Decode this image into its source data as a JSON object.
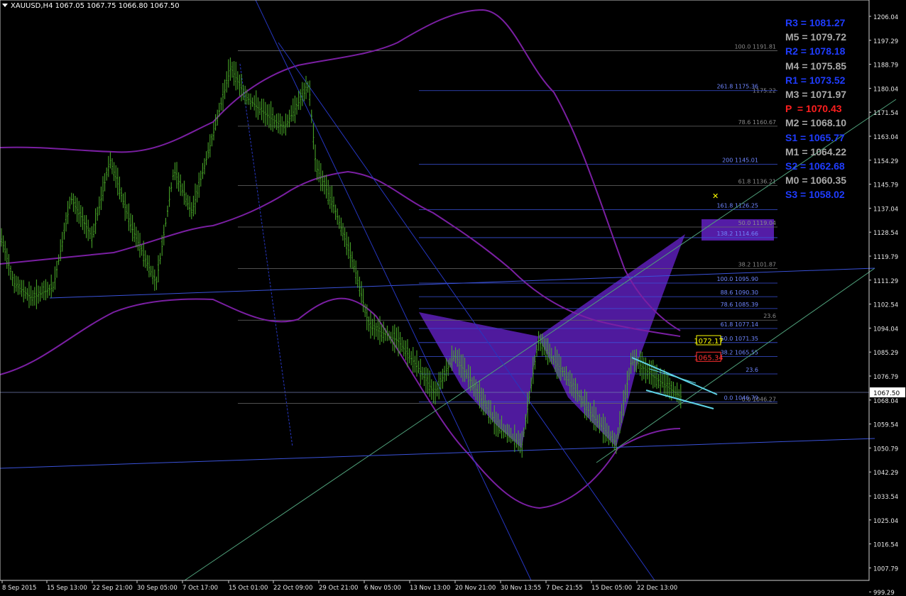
{
  "header": {
    "symbol": "XAUUSD,H4",
    "ohlc": "1067.05 1067.75 1066.80 1067.50"
  },
  "current_price": {
    "value": 1067.5,
    "label": "1067.50"
  },
  "price_axis": {
    "labels": [
      "1206.04",
      "1197.29",
      "1188.79",
      "1180.04",
      "1171.54",
      "1163.04",
      "1154.29",
      "1145.79",
      "1137.04",
      "1128.54",
      "1119.79",
      "1111.29",
      "1102.54",
      "1094.04",
      "1085.29",
      "1076.79",
      "1068.04",
      "1059.54",
      "1050.79",
      "1042.29",
      "1033.54",
      "1025.04",
      "1016.54",
      "1007.79",
      "999.29"
    ]
  },
  "time_axis": {
    "labels": [
      "8 Sep 2015",
      "15 Sep 13:00",
      "22 Sep 21:00",
      "30 Sep 05:00",
      "7 Oct 17:00",
      "15 Oct 01:00",
      "22 Oct 09:00",
      "29 Oct 21:00",
      "6 Nov 05:00",
      "13 Nov 13:00",
      "20 Nov 21:00",
      "30 Nov 13:55",
      "7 Dec 21:55",
      "15 Dec 05:00",
      "22 Dec 13:00"
    ]
  },
  "pivots": [
    {
      "label": "R3",
      "value": "1081.27",
      "color": "#1f3cff"
    },
    {
      "label": "M5",
      "value": "1079.72",
      "color": "#a9a9a9"
    },
    {
      "label": "R2",
      "value": "1078.18",
      "color": "#1f3cff"
    },
    {
      "label": "M4",
      "value": "1075.85",
      "color": "#a9a9a9"
    },
    {
      "label": "R1",
      "value": "1073.52",
      "color": "#1f3cff"
    },
    {
      "label": "M3",
      "value": "1071.97",
      "color": "#a9a9a9"
    },
    {
      "label": "P ",
      "value": "1070.43",
      "color": "#ff1f1f"
    },
    {
      "label": "M2",
      "value": "1068.10",
      "color": "#a9a9a9"
    },
    {
      "label": "S1",
      "value": "1065.77",
      "color": "#1f3cff"
    },
    {
      "label": "M1",
      "value": "1064.22",
      "color": "#a9a9a9"
    },
    {
      "label": "S2",
      "value": "1062.68",
      "color": "#1f3cff"
    },
    {
      "label": "M0",
      "value": "1060.35",
      "color": "#a9a9a9"
    },
    {
      "label": "S3",
      "value": "1058.02",
      "color": "#1f3cff"
    }
  ],
  "fib_grey": [
    {
      "label": "100.0 1191.81",
      "price": 1191.81
    },
    {
      "label": "78.6 1160.67",
      "price": 1160.67
    },
    {
      "label": "61.8 1136.21",
      "price": 1136.21
    },
    {
      "label": "50.0 1119.04",
      "price": 1119.04
    },
    {
      "label": "38.2 1101.87",
      "price": 1101.87
    },
    {
      "label": "23.6",
      "price": 1080.6
    },
    {
      "label": "0.0 1046.27",
      "price": 1046.27
    }
  ],
  "fib_blue": [
    {
      "label": "261.8 1175.36",
      "price": 1175.36
    },
    {
      "label": "200 1145.01",
      "price": 1145.01
    },
    {
      "label": "161.8 1126.25",
      "price": 1126.25
    },
    {
      "label": "138.2 1114.66",
      "price": 1114.66
    },
    {
      "label": "100.0 1095.90",
      "price": 1095.9
    },
    {
      "label": "88.6 1090.30",
      "price": 1090.3
    },
    {
      "label": "78.6 1085.39",
      "price": 1085.39
    },
    {
      "label": "61.8 1077.14",
      "price": 1077.14
    },
    {
      "label": "50.0 1071.35",
      "price": 1071.35
    },
    {
      "label": "38.2 1065.55",
      "price": 1065.55
    },
    {
      "label": "23.6",
      "price": 1058.4
    },
    {
      "label": "0.0 1046.79",
      "price": 1046.79
    }
  ],
  "fib_extra_grey": "1175.22",
  "price_tags": [
    {
      "label": "1072.17",
      "price": 1072.17,
      "color": "#ffff00"
    },
    {
      "label": "1065.34",
      "price": 1065.34,
      "color": "#ff3030"
    }
  ],
  "colors": {
    "candles": "#4caf2a",
    "bollinger": "#7a1fa2",
    "pattern": "#5d1fb8",
    "trendline": "#4fa07a",
    "fib": "#3a52d9",
    "wedge": "#5fd3e6"
  }
}
